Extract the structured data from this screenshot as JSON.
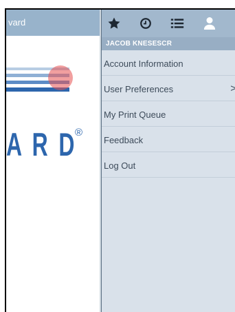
{
  "app": {
    "header_title": "vard",
    "logo_text": "A R D",
    "logo_registered": "®"
  },
  "toolbar": {
    "icons": [
      "star-icon",
      "clock-icon",
      "list-icon",
      "user-icon"
    ]
  },
  "menu": {
    "user_name": "JACOB KNESESCR",
    "items": [
      {
        "label": "Account Information",
        "has_submenu": false
      },
      {
        "label": "User Preferences",
        "has_submenu": true
      },
      {
        "label": "My Print Queue",
        "has_submenu": false
      },
      {
        "label": "Feedback",
        "has_submenu": false
      },
      {
        "label": "Log Out",
        "has_submenu": false
      }
    ],
    "submenu_indicator": ">"
  },
  "colors": {
    "header_blue": "#98b3cb",
    "logo_blue": "#2d66ad",
    "menu_bg": "#d9e1ea",
    "click_marker": "#e55050"
  }
}
